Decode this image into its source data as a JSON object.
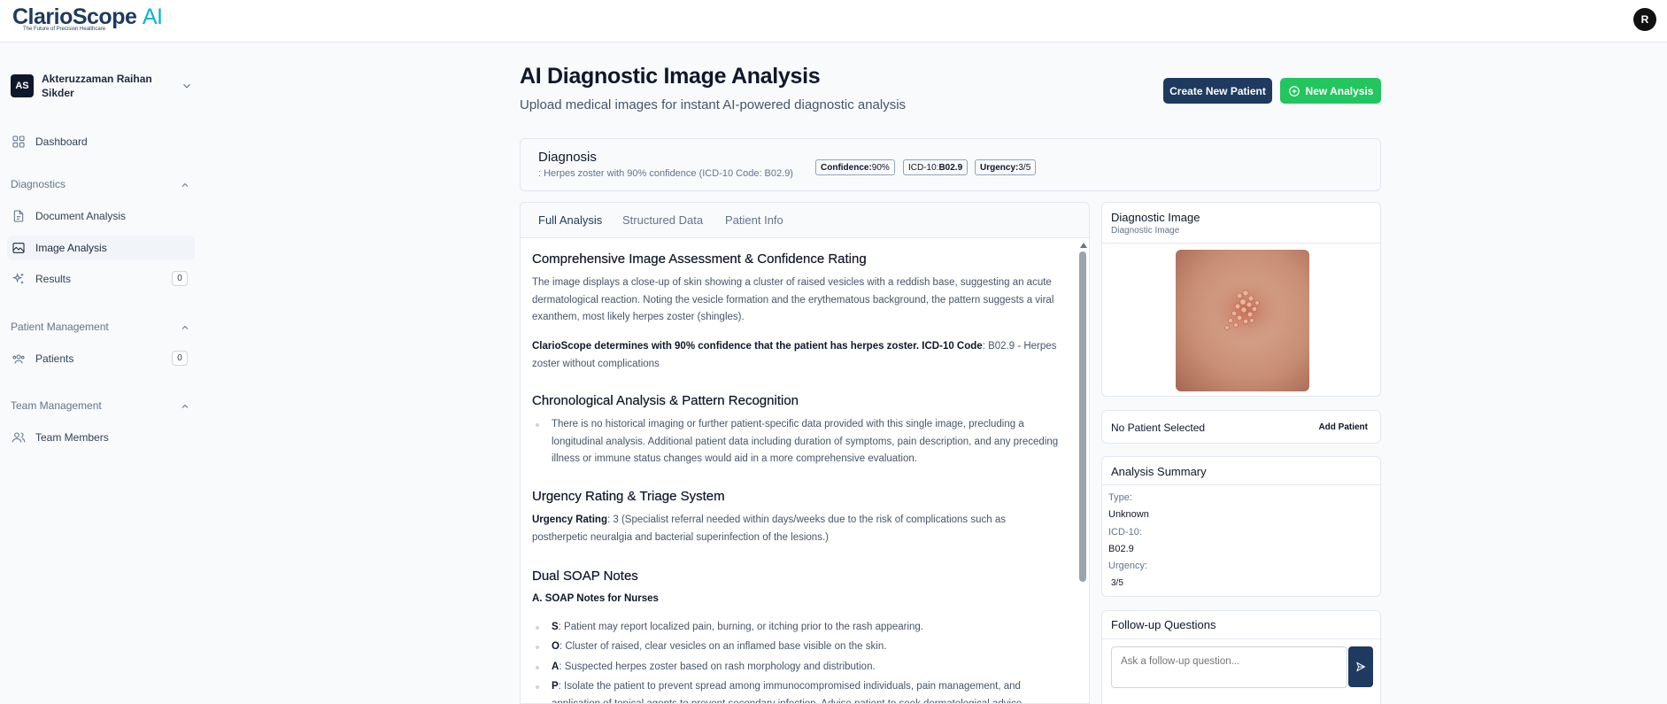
{
  "brand": {
    "name": "ClarioScope",
    "suffix": "AI",
    "tagline": "The Future of Precision Healthcare"
  },
  "topbar": {
    "user_initial": "R"
  },
  "sidebar": {
    "user": {
      "initials": "AS",
      "name": "Akteruzzaman Raihan Sikder"
    },
    "dashboard": {
      "label": "Dashboard",
      "icon": "grid-icon"
    },
    "sections": [
      {
        "title": "Diagnostics",
        "items": [
          {
            "label": "Document Analysis",
            "icon": "document-icon"
          },
          {
            "label": "Image Analysis",
            "icon": "image-icon",
            "active": true
          },
          {
            "label": "Results",
            "icon": "sparkles-icon",
            "count": "0"
          }
        ]
      },
      {
        "title": "Patient Management",
        "items": [
          {
            "label": "Patients",
            "icon": "users-icon",
            "count": "0"
          }
        ]
      },
      {
        "title": "Team Management",
        "items": [
          {
            "label": "Team Members",
            "icon": "team-icon"
          }
        ]
      }
    ]
  },
  "header": {
    "title": "AI Diagnostic Image Analysis",
    "subtitle": "Upload medical images for instant AI-powered diagnostic analysis",
    "create_patient": "Create New Patient",
    "new_analysis": "New Analysis"
  },
  "diagnosis": {
    "title": "Diagnosis",
    "text": ": Herpes zoster with 90% confidence (ICD-10 Code: B02.9)",
    "badges": {
      "confidence_label": "Confidence:",
      "confidence_value": "90%",
      "icd_label": "ICD-10:",
      "icd_value": "B02.9",
      "urgency_label": "Urgency:",
      "urgency_value": "3/5"
    }
  },
  "tabs": [
    "Full Analysis",
    "Structured Data",
    "Patient Info"
  ],
  "analysis": {
    "s1_title": "Comprehensive Image Assessment & Confidence Rating",
    "s1_p1": "The image displays a close-up of skin showing a cluster of raised vesicles with a reddish base, suggesting an acute dermatological reaction. Noting the vesicle formation and the erythematous background, the pattern suggests a viral exanthem, most likely herpes zoster (shingles).",
    "s1_p2_bold": "ClarioScope determines with 90% confidence that the patient has herpes zoster. ICD-10 Code",
    "s1_p2_rest": ": B02.9 - Herpes zoster without complications",
    "s2_title": "Chronological Analysis & Pattern Recognition",
    "s2_b1": "There is no historical imaging or further patient-specific data provided with this single image, precluding a longitudinal analysis. Additional patient data including duration of symptoms, pain description, and any preceding illness or immune status changes would aid in a more comprehensive evaluation.",
    "s3_title": "Urgency Rating & Triage System",
    "s3_bold": "Urgency Rating",
    "s3_rest": ": 3 (Specialist referral needed within days/weeks due to the risk of complications such as postherpetic neuralgia and bacterial superinfection of the lesions.)",
    "s4_title": "Dual SOAP Notes",
    "s4_sub": "A. SOAP Notes for Nurses",
    "soap": [
      {
        "k": "S",
        "v": ": Patient may report localized pain, burning, or itching prior to the rash appearing."
      },
      {
        "k": "O",
        "v": ": Cluster of raised, clear vesicles on an inflamed base visible on the skin."
      },
      {
        "k": "A",
        "v": ": Suspected herpes zoster based on rash morphology and distribution."
      },
      {
        "k": "P",
        "v": ": Isolate the patient to prevent spread among immunocompromised individuals, pain management, and application of topical agents to prevent secondary infection. Advise patient to seek dermatological advice."
      }
    ]
  },
  "image_card": {
    "title": "Diagnostic Image",
    "subtitle": "Diagnostic Image"
  },
  "patient_card": {
    "text": "No Patient Selected",
    "add": "Add Patient"
  },
  "summary": {
    "title": "Analysis Summary",
    "type_label": "Type:",
    "type_value": "Unknown",
    "icd_label": "ICD-10:",
    "icd_value": "B02.9",
    "urgency_label": "Urgency:",
    "urgency_value": "3/5"
  },
  "followup": {
    "title": "Follow-up Questions",
    "placeholder": "Ask a follow-up question..."
  },
  "colors": {
    "primary": "#1e3a5f",
    "accent": "#22c55e",
    "brand_cyan": "#06b6d4"
  }
}
